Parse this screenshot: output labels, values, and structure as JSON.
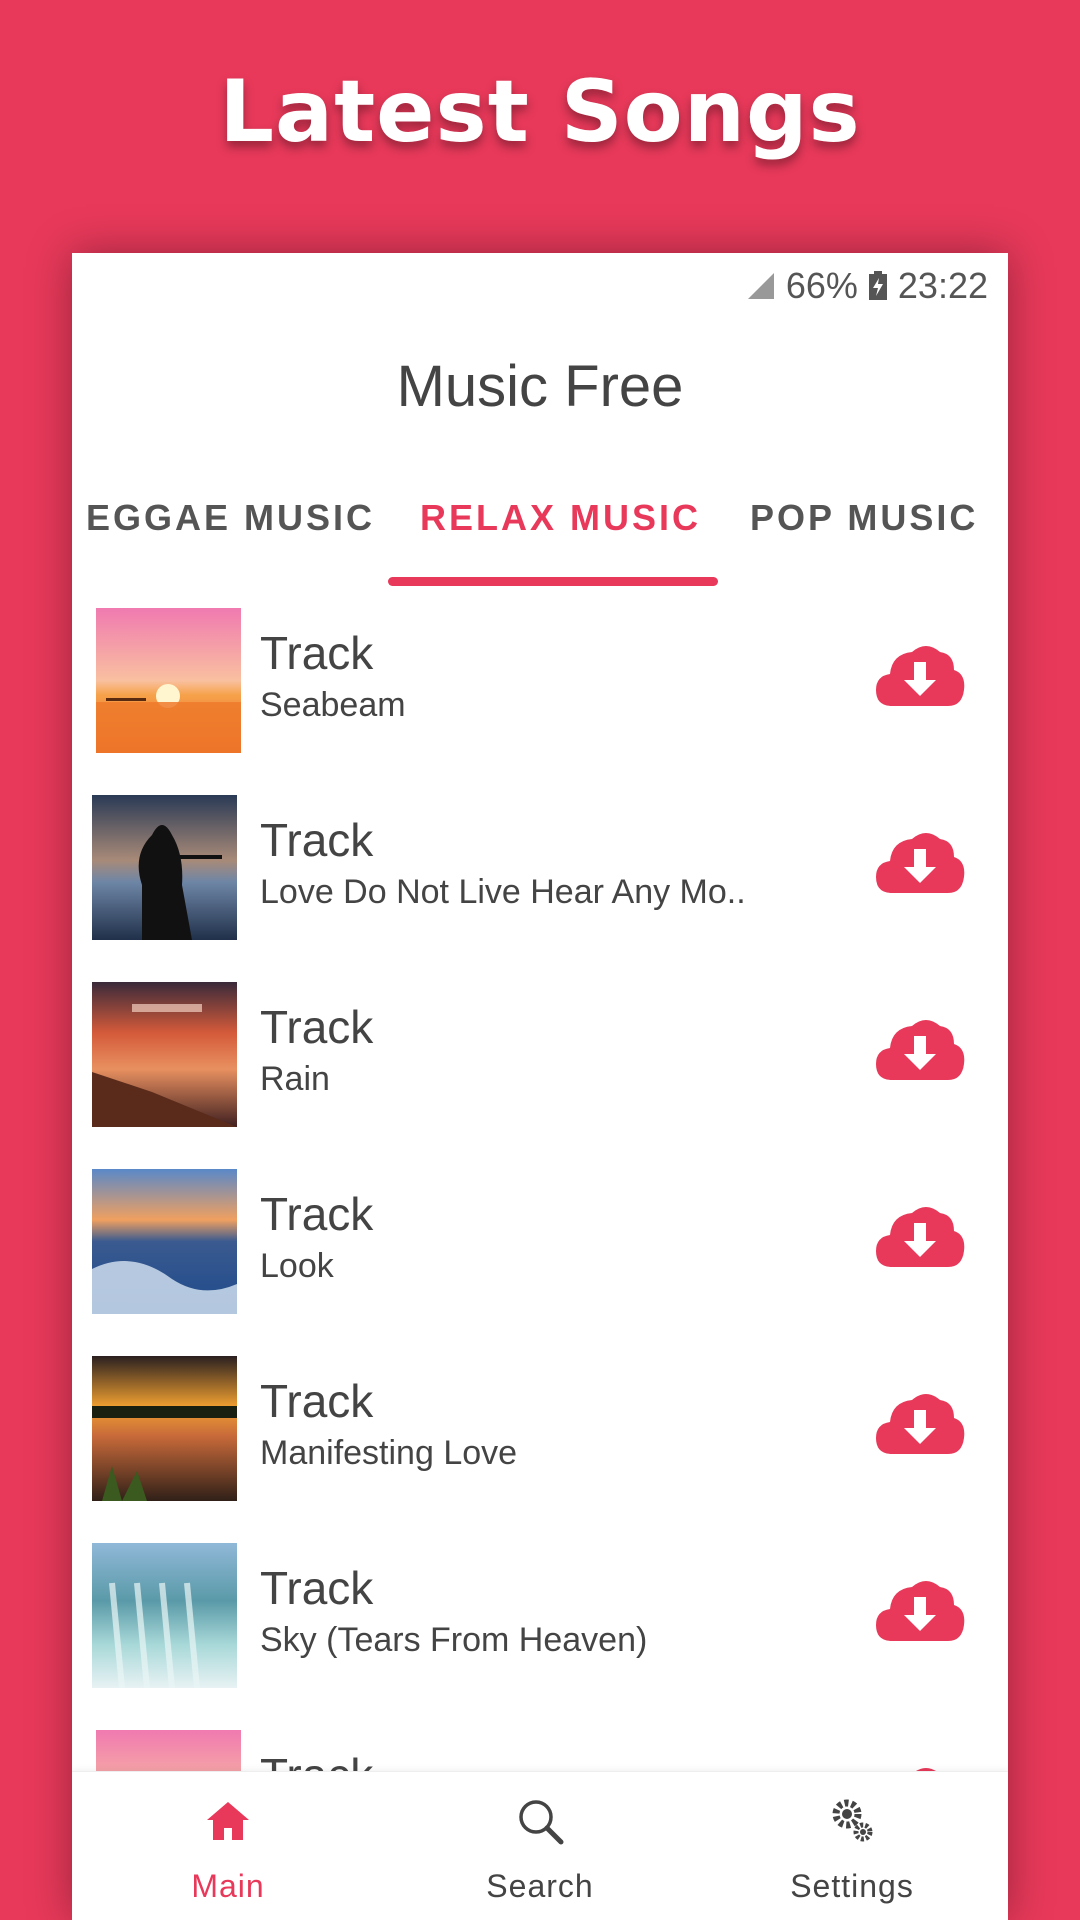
{
  "banner": {
    "title": "Latest Songs"
  },
  "status_bar": {
    "battery": "66%",
    "time": "23:22"
  },
  "app": {
    "title": "Music Free"
  },
  "tabs": [
    {
      "label": "EGGAE MUSIC",
      "active": false
    },
    {
      "label": "RELAX MUSIC",
      "active": true
    },
    {
      "label": "POP MUSIC",
      "active": false
    }
  ],
  "tracks": [
    {
      "title": "Track",
      "subtitle": "Seabeam"
    },
    {
      "title": "Track",
      "subtitle": "Love Do Not Live Hear Any Mo.."
    },
    {
      "title": "Track",
      "subtitle": "Rain"
    },
    {
      "title": "Track",
      "subtitle": "Look"
    },
    {
      "title": "Track",
      "subtitle": "Manifesting Love"
    },
    {
      "title": "Track",
      "subtitle": "Sky (Tears From Heaven)"
    },
    {
      "title": "Track",
      "subtitle": ""
    }
  ],
  "bottom_nav": [
    {
      "label": "Main",
      "icon": "home-icon",
      "active": true
    },
    {
      "label": "Search",
      "icon": "search-icon",
      "active": false
    },
    {
      "label": "Settings",
      "icon": "gear-icon",
      "active": false
    }
  ],
  "colors": {
    "accent": "#e8395a",
    "text": "#444444"
  }
}
